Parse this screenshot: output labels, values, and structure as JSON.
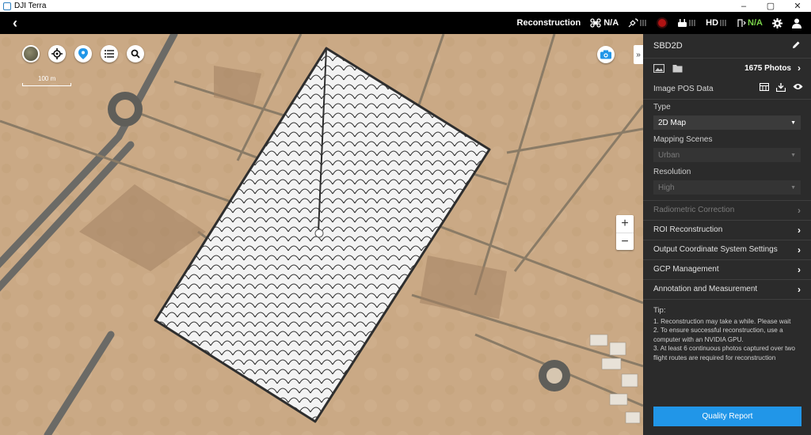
{
  "window": {
    "title": "DJI Terra",
    "controls": [
      "–",
      "▢",
      "✕"
    ]
  },
  "topbar": {
    "back_icon": "‹",
    "mode": "Reconstruction",
    "drone_status": "N/A",
    "hd_label": "HD",
    "battery_status": "N/A",
    "accent_green": "#7ad34a"
  },
  "map": {
    "scale_label": "100 m",
    "zoom_in": "+",
    "zoom_out": "−",
    "collapse_icon": "»",
    "route_color": "#3b3b3b",
    "tools": [
      "satellite-layer-icon",
      "locate-icon",
      "waypoint-pin-icon",
      "list-icon",
      "search-icon"
    ]
  },
  "panel": {
    "project_name": "SBD2D",
    "photo_count": "1675 Photos",
    "image_pos_label": "Image POS Data",
    "type": {
      "label": "Type",
      "value": "2D Map"
    },
    "mapping_scenes": {
      "label": "Mapping Scenes",
      "value": "Urban"
    },
    "resolution": {
      "label": "Resolution",
      "value": "High"
    },
    "menu": [
      {
        "label": "Radiometric Correction",
        "enabled": false
      },
      {
        "label": "ROI Reconstruction",
        "enabled": true
      },
      {
        "label": "Output Coordinate System Settings",
        "enabled": true
      },
      {
        "label": "GCP Management",
        "enabled": true
      },
      {
        "label": "Annotation and Measurement",
        "enabled": true
      }
    ],
    "tip": {
      "title": "Tip:",
      "lines": [
        "1. Reconstruction may take a while. Please wait",
        "2. To ensure successful reconstruction, use a computer with an NVIDIA GPU.",
        "3. At least 6 continuous photos captured over two flight routes are required for reconstruction"
      ]
    },
    "quality_button": "Quality Report",
    "button_color": "#2196e8"
  }
}
